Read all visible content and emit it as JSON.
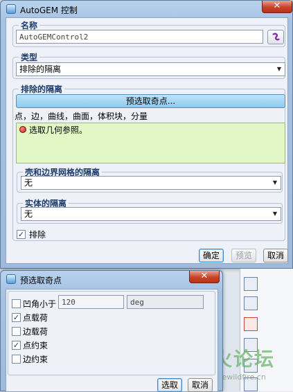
{
  "main_dialog": {
    "title": "AutoGEM 控制",
    "close_glyph": "✕",
    "name_group": {
      "legend": "名称",
      "value": "AutoGEMControl2"
    },
    "type_group": {
      "legend": "类型",
      "selected": "排除的隔离"
    },
    "exclusion_group": {
      "legend": "排除的隔离",
      "preselect_button": "预选取奇点...",
      "hint": "点，边，曲线，曲面，体积块，分量",
      "collector_text": "选取几何参照。",
      "shell_group": {
        "legend": "壳和边界网格的隔离",
        "selected": "无"
      },
      "solid_group": {
        "legend": "实体的隔离",
        "selected": "无"
      }
    },
    "exclude_checkbox": {
      "label": "排除",
      "checked": true
    },
    "buttons": {
      "ok": "确定",
      "preview": "预览",
      "cancel": "取消"
    }
  },
  "preselect_dialog": {
    "title": "预选取奇点",
    "close_glyph": "✕",
    "items": [
      {
        "label": "凹角小于",
        "checked": false
      },
      {
        "label": "点载荷",
        "checked": true
      },
      {
        "label": "边载荷",
        "checked": false
      },
      {
        "label": "点约束",
        "checked": true
      },
      {
        "label": "边约束",
        "checked": false
      }
    ],
    "angle_value": "120",
    "angle_unit": "deg",
    "buttons": {
      "select": "选取",
      "cancel": "取消"
    }
  },
  "watermark": {
    "title": "野火论坛",
    "url": "www.proewildfire.cn"
  },
  "colors": {
    "collector_bg": "#e2f7c6",
    "preselect_btn": "#9fd3f3",
    "error_dot": "#c0201a"
  }
}
